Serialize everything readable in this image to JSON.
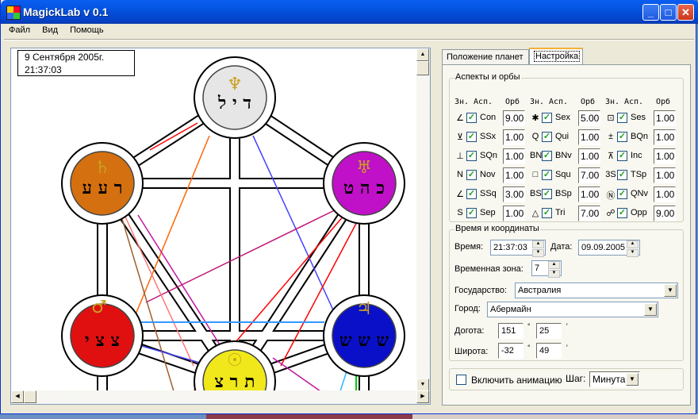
{
  "window": {
    "title": "MagickLab v 0.1",
    "controls": {
      "minimize": "_",
      "maximize": "□",
      "close": "✕"
    }
  },
  "menu": [
    "Файл",
    "Вид",
    "Помощь"
  ],
  "canvas": {
    "date_line": "9 Сентября 2005г.",
    "time_line": "21:37:03",
    "spheres": [
      {
        "name": "top",
        "letters": "ד י ל",
        "color": "#e6e6e6",
        "planet_icon": "neptune-icon"
      },
      {
        "name": "left-upper",
        "letters": "ר ע ע",
        "color": "#d47010",
        "planet_icon": "saturn-icon"
      },
      {
        "name": "right-upper",
        "letters": "כ ה ט",
        "color": "#c010c8",
        "planet_icon": "uranus-icon"
      },
      {
        "name": "left-lower",
        "letters": "צ צ י",
        "color": "#e01010",
        "planet_icon": "mars-icon"
      },
      {
        "name": "right-lower",
        "letters": "ש ש ש",
        "color": "#0a10c8",
        "planet_icon": "jupiter-icon"
      },
      {
        "name": "bottom",
        "letters": "ת ר צ",
        "color": "#f0e81a",
        "planet_icon": "sun-icon"
      }
    ]
  },
  "tabs": [
    {
      "label": "Положение планет",
      "active": false
    },
    {
      "label": "Настройка",
      "active": true
    }
  ],
  "aspects": {
    "legend": "Аспекты и орбы",
    "headers": [
      "Зн.",
      "Асп.",
      "Орб"
    ],
    "columns": [
      [
        {
          "sym": "∠",
          "label": "Con",
          "checked": true,
          "orb": "9.00"
        },
        {
          "sym": "⊻",
          "label": "SSx",
          "checked": true,
          "orb": "1.00"
        },
        {
          "sym": "⊥",
          "label": "SQn",
          "checked": true,
          "orb": "1.00"
        },
        {
          "sym": "N",
          "label": "Nov",
          "checked": true,
          "orb": "1.00"
        },
        {
          "sym": "∠",
          "label": "SSq",
          "checked": true,
          "orb": "3.00"
        },
        {
          "sym": "S",
          "label": "Sep",
          "checked": true,
          "orb": "1.00"
        }
      ],
      [
        {
          "sym": "✱",
          "label": "Sex",
          "checked": true,
          "orb": "5.00"
        },
        {
          "sym": "Q",
          "label": "Qui",
          "checked": true,
          "orb": "1.00"
        },
        {
          "sym": "BN",
          "label": "BNv",
          "checked": true,
          "orb": "1.00"
        },
        {
          "sym": "□",
          "label": "Squ",
          "checked": true,
          "orb": "7.00"
        },
        {
          "sym": "BS",
          "label": "BSp",
          "checked": true,
          "orb": "1.00"
        },
        {
          "sym": "△",
          "label": "Tri",
          "checked": true,
          "orb": "7.00"
        }
      ],
      [
        {
          "sym": "⊡",
          "label": "Ses",
          "checked": true,
          "orb": "1.00"
        },
        {
          "sym": "±",
          "label": "BQn",
          "checked": true,
          "orb": "1.00"
        },
        {
          "sym": "⊼",
          "label": "Inc",
          "checked": true,
          "orb": "1.00"
        },
        {
          "sym": "3S",
          "label": "TSp",
          "checked": true,
          "orb": "1.00"
        },
        {
          "sym": "Ⓝ",
          "label": "QNv",
          "checked": true,
          "orb": "1.00"
        },
        {
          "sym": "☍",
          "label": "Opp",
          "checked": true,
          "orb": "9.00"
        }
      ]
    ]
  },
  "timecoords": {
    "legend": "Время и координаты",
    "time_label": "Время:",
    "time_value": "21:37:03",
    "date_label": "Дата:",
    "date_value": "09.09.2005",
    "tz_label": "Временная зона:",
    "tz_value": "7",
    "country_label": "Государство:",
    "country_value": "Австралия",
    "city_label": "Город:",
    "city_value": "Абермайн",
    "lon_label": "Догота:",
    "lon_deg": "151",
    "lon_min": "25",
    "lat_label": "Широта:",
    "lat_deg": "-32",
    "lat_min": "49",
    "deg_sign": "°",
    "min_sign": "′"
  },
  "animation": {
    "checkbox_label": "Включить анимацию",
    "checked": false,
    "step_label": "Шаг:",
    "step_value": "Минута"
  }
}
